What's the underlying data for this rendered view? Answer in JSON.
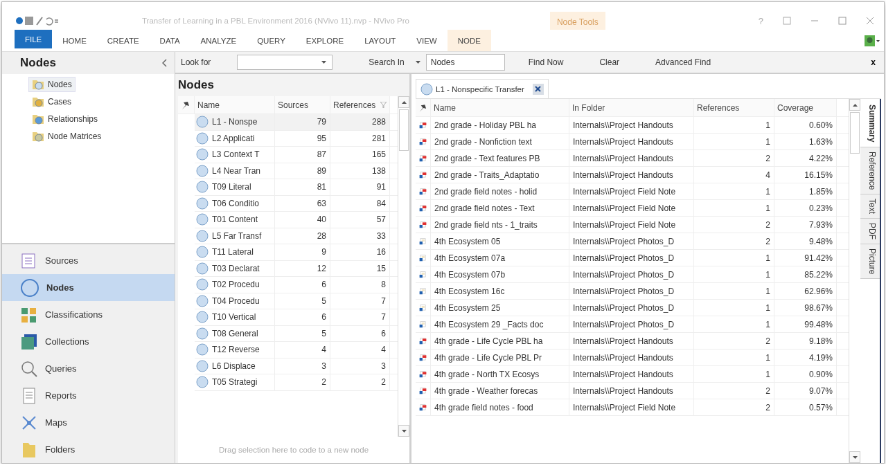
{
  "title_bar": {
    "title": "Transfer of Learning in a PBL Environment 2016 (NVivo 11).nvp - NVivo Pro",
    "context_group": "Node Tools",
    "help": "?"
  },
  "ribbon_tabs": [
    {
      "label": "FILE",
      "kind": "file"
    },
    {
      "label": "HOME",
      "kind": "plain"
    },
    {
      "label": "CREATE",
      "kind": "plain"
    },
    {
      "label": "DATA",
      "kind": "plain"
    },
    {
      "label": "ANALYZE",
      "kind": "plain"
    },
    {
      "label": "QUERY",
      "kind": "plain"
    },
    {
      "label": "EXPLORE",
      "kind": "plain"
    },
    {
      "label": "LAYOUT",
      "kind": "plain"
    },
    {
      "label": "VIEW",
      "kind": "plain"
    },
    {
      "label": "NODE",
      "kind": "context"
    }
  ],
  "navigation": {
    "title": "Nodes",
    "tree": [
      {
        "label": "Nodes",
        "selected": true
      },
      {
        "label": "Cases",
        "selected": false
      },
      {
        "label": "Relationships",
        "selected": false
      },
      {
        "label": "Node Matrices",
        "selected": false
      }
    ],
    "sections": [
      {
        "label": "Sources",
        "selected": false
      },
      {
        "label": "Nodes",
        "selected": true
      },
      {
        "label": "Classifications",
        "selected": false
      },
      {
        "label": "Collections",
        "selected": false
      },
      {
        "label": "Queries",
        "selected": false
      },
      {
        "label": "Reports",
        "selected": false
      },
      {
        "label": "Maps",
        "selected": false
      },
      {
        "label": "Folders",
        "selected": false
      }
    ]
  },
  "find_bar": {
    "look_for_label": "Look for",
    "search_in_label": "Search In",
    "search_in_value": "Nodes",
    "buttons": [
      "Find Now",
      "Clear",
      "Advanced Find"
    ],
    "close": "x"
  },
  "node_list": {
    "title": "Nodes",
    "columns": [
      "Name",
      "Sources",
      "References"
    ],
    "rows": [
      {
        "name": "L1 - Nonspe",
        "sources": "79",
        "references": "288",
        "selected": true
      },
      {
        "name": "L2 Applicati",
        "sources": "95",
        "references": "281",
        "selected": false
      },
      {
        "name": "L3 Context T",
        "sources": "87",
        "references": "165",
        "selected": false
      },
      {
        "name": "L4 Near Tran",
        "sources": "89",
        "references": "138",
        "selected": false
      },
      {
        "name": "T09 Literal",
        "sources": "81",
        "references": "91",
        "selected": false
      },
      {
        "name": "T06 Conditio",
        "sources": "63",
        "references": "84",
        "selected": false
      },
      {
        "name": "T01 Content",
        "sources": "40",
        "references": "57",
        "selected": false
      },
      {
        "name": "L5 Far Transf",
        "sources": "28",
        "references": "33",
        "selected": false
      },
      {
        "name": "T11 Lateral",
        "sources": "9",
        "references": "16",
        "selected": false
      },
      {
        "name": "T03 Declarat",
        "sources": "12",
        "references": "15",
        "selected": false
      },
      {
        "name": "T02 Procedu",
        "sources": "6",
        "references": "8",
        "selected": false
      },
      {
        "name": "T04 Procedu",
        "sources": "5",
        "references": "7",
        "selected": false
      },
      {
        "name": "T10 Vertical",
        "sources": "6",
        "references": "7",
        "selected": false
      },
      {
        "name": "T08 General",
        "sources": "5",
        "references": "6",
        "selected": false
      },
      {
        "name": "T12 Reverse",
        "sources": "4",
        "references": "4",
        "selected": false
      },
      {
        "name": "L6 Displace",
        "sources": "3",
        "references": "3",
        "selected": false
      },
      {
        "name": "T05 Strategi",
        "sources": "2",
        "references": "2",
        "selected": false
      }
    ],
    "drop_hint": "Drag selection here to code to a new node"
  },
  "detail": {
    "tab": "L1 - Nonspecific Transfer",
    "columns": [
      "Name",
      "In Folder",
      "References",
      "Coverage"
    ],
    "rows": [
      {
        "kind": "document",
        "name": "2nd grade - Holiday PBL ha",
        "folder": "Internals\\\\Project Handouts",
        "references": "1",
        "coverage": "0.60%"
      },
      {
        "kind": "document",
        "name": "2nd grade - Nonfiction text",
        "folder": "Internals\\\\Project Handouts",
        "references": "1",
        "coverage": "1.63%"
      },
      {
        "kind": "document",
        "name": "2nd grade - Text features PB",
        "folder": "Internals\\\\Project Handouts",
        "references": "2",
        "coverage": "4.22%"
      },
      {
        "kind": "document",
        "name": "2nd grade - Traits_Adaptatio",
        "folder": "Internals\\\\Project Handouts",
        "references": "4",
        "coverage": "16.15%"
      },
      {
        "kind": "document",
        "name": "2nd grade field notes - holid",
        "folder": "Internals\\\\Project Field Note",
        "references": "1",
        "coverage": "1.85%"
      },
      {
        "kind": "document",
        "name": "2nd grade field notes - Text",
        "folder": "Internals\\\\Project Field Note",
        "references": "1",
        "coverage": "0.23%"
      },
      {
        "kind": "document",
        "name": "2nd grade field nts - 1_traits",
        "folder": "Internals\\\\Project Field Note",
        "references": "2",
        "coverage": "7.93%"
      },
      {
        "kind": "image",
        "name": "4th Ecosystem 05",
        "folder": "Internals\\\\Project Photos_D",
        "references": "2",
        "coverage": "9.48%"
      },
      {
        "kind": "image",
        "name": "4th Ecosystem 07a",
        "folder": "Internals\\\\Project Photos_D",
        "references": "1",
        "coverage": "91.42%"
      },
      {
        "kind": "image",
        "name": "4th Ecosystem 07b",
        "folder": "Internals\\\\Project Photos_D",
        "references": "1",
        "coverage": "85.22%"
      },
      {
        "kind": "image",
        "name": "4th Ecosystem 16c",
        "folder": "Internals\\\\Project Photos_D",
        "references": "1",
        "coverage": "62.96%"
      },
      {
        "kind": "image",
        "name": "4th Ecosystem 25",
        "folder": "Internals\\\\Project Photos_D",
        "references": "1",
        "coverage": "98.67%"
      },
      {
        "kind": "image",
        "name": "4th Ecosystem 29 _Facts doc",
        "folder": "Internals\\\\Project Photos_D",
        "references": "1",
        "coverage": "99.48%"
      },
      {
        "kind": "document",
        "name": "4th grade - Life Cycle PBL ha",
        "folder": "Internals\\\\Project Handouts",
        "references": "2",
        "coverage": "9.18%"
      },
      {
        "kind": "document",
        "name": "4th grade - Life Cycle PBL Pr",
        "folder": "Internals\\\\Project Handouts",
        "references": "1",
        "coverage": "4.19%"
      },
      {
        "kind": "document",
        "name": "4th grade - North TX Ecosys",
        "folder": "Internals\\\\Project Handouts",
        "references": "1",
        "coverage": "0.90%"
      },
      {
        "kind": "document",
        "name": "4th grade - Weather forecas",
        "folder": "Internals\\\\Project Handouts",
        "references": "2",
        "coverage": "9.07%"
      },
      {
        "kind": "document",
        "name": "4th grade field notes - food",
        "folder": "Internals\\\\Project Field Note",
        "references": "2",
        "coverage": "0.57%"
      }
    ],
    "side_tabs": [
      {
        "label": "Summary",
        "selected": true
      },
      {
        "label": "Reference",
        "selected": false
      },
      {
        "label": "Text",
        "selected": false
      },
      {
        "label": "PDF",
        "selected": false
      },
      {
        "label": "Picture",
        "selected": false
      }
    ]
  }
}
